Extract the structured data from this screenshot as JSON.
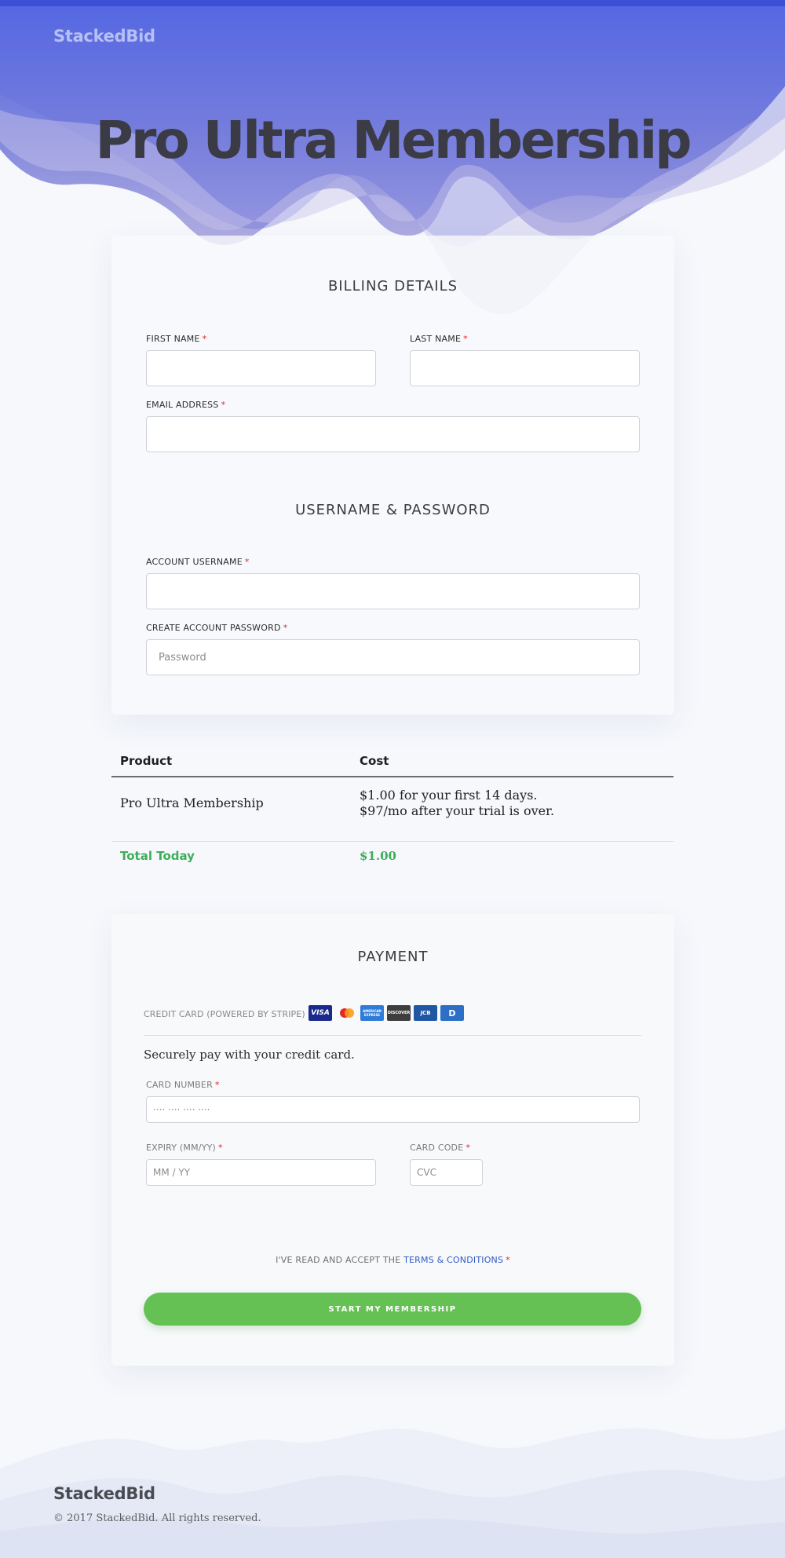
{
  "brand": {
    "name": "StackedBid"
  },
  "hero": {
    "title": "Pro Ultra Membership"
  },
  "billing": {
    "section_title": "BILLING DETAILS",
    "first_name": {
      "label": "FIRST NAME",
      "value": ""
    },
    "last_name": {
      "label": "LAST NAME",
      "value": ""
    },
    "email": {
      "label": "EMAIL ADDRESS",
      "value": ""
    }
  },
  "account": {
    "section_title": "USERNAME & PASSWORD",
    "username": {
      "label": "ACCOUNT USERNAME",
      "value": ""
    },
    "password": {
      "label": "CREATE ACCOUNT PASSWORD",
      "placeholder": "Password"
    }
  },
  "required_marker": "*",
  "order": {
    "headers": {
      "product": "Product",
      "cost": "Cost"
    },
    "row": {
      "product": "Pro Ultra Membership",
      "cost_line1": "$1.00 for your first 14 days.",
      "cost_line2": "$97/mo after your trial is over."
    },
    "total_label": "Total Today",
    "total_value": "$1.00"
  },
  "payment": {
    "section_title": "PAYMENT",
    "method_label": "CREDIT CARD (POWERED BY STRIPE)",
    "card_logos": [
      "VISA",
      "",
      "AMERICAN EXPRESS",
      "DISCOVER",
      "JCB",
      "D"
    ],
    "secure_text": "Securely pay with your credit card.",
    "card_number": {
      "label": "CARD NUMBER",
      "placeholder": "···· ···· ···· ····"
    },
    "expiry": {
      "label": "EXPIRY (MM/YY)",
      "placeholder": "MM / YY"
    },
    "card_code": {
      "label": "CARD CODE",
      "placeholder": "CVC"
    },
    "terms_prefix": "I'VE READ AND ACCEPT THE",
    "terms_link": "TERMS & CONDITIONS",
    "submit_label": "START MY MEMBERSHIP"
  },
  "footer": {
    "brand": "StackedBid",
    "copyright": "© 2017 StackedBid. All rights reserved."
  },
  "colors": {
    "hero_top": "#4b63e6",
    "accent_green": "#65c153",
    "total_green": "#3fae5a",
    "link_blue": "#2e59c9",
    "required_red": "#e0282d"
  }
}
